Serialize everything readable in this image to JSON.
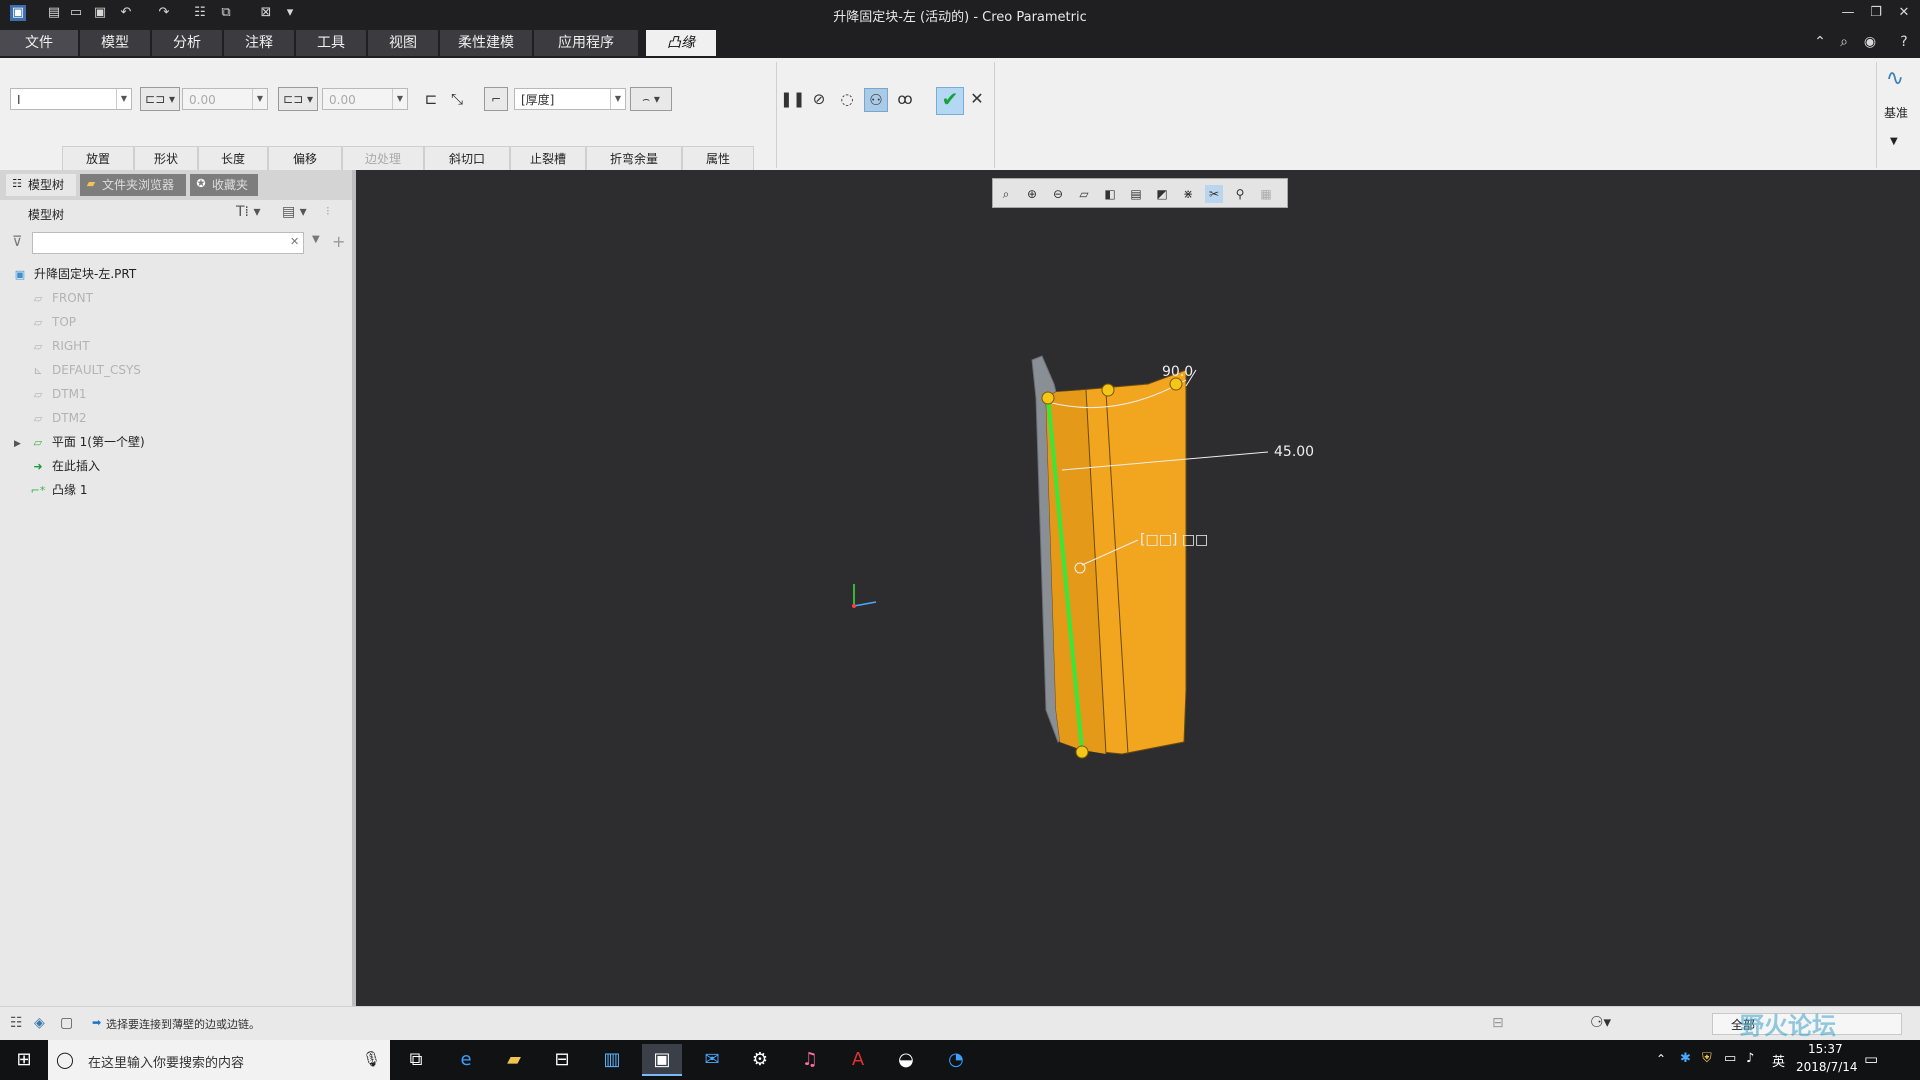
{
  "window": {
    "title": "升降固定块-左 (活动的) - Creo Parametric",
    "quick_access_icons": [
      "app-icon",
      "new-icon",
      "open-icon",
      "save-icon",
      "undo-icon",
      "redo-icon",
      "regenerate-icon",
      "windows-icon",
      "close-window-icon",
      "customize-icon"
    ],
    "controls": [
      "minimize-icon",
      "restore-icon",
      "close-icon"
    ]
  },
  "menu": {
    "tabs": [
      "文件",
      "模型",
      "分析",
      "注释",
      "工具",
      "视图",
      "柔性建模",
      "应用程序",
      "凸缘"
    ],
    "active_tab": "凸缘",
    "right_icons": [
      "collapse-ribbon-icon",
      "search-icon",
      "community-icon",
      "help-icon"
    ]
  },
  "ribbon": {
    "shape_select": "I",
    "length1_value": "0.00",
    "length2_value": "0.00",
    "thickness_select": "[厚度]",
    "controls": [
      "pause-icon",
      "cancel-feature-icon",
      "preview-icon",
      "verify-icon",
      "glasses-icon"
    ],
    "datum_label": "基准",
    "slideup_tabs": [
      {
        "label": "放置",
        "enabled": true
      },
      {
        "label": "形状",
        "enabled": true
      },
      {
        "label": "长度",
        "enabled": true
      },
      {
        "label": "偏移",
        "enabled": true
      },
      {
        "label": "边处理",
        "enabled": false
      },
      {
        "label": "斜切口",
        "enabled": true
      },
      {
        "label": "止裂槽",
        "enabled": true
      },
      {
        "label": "折弯余量",
        "enabled": true
      },
      {
        "label": "属性",
        "enabled": true
      }
    ]
  },
  "left_panel": {
    "tabs": [
      "模型树",
      "文件夹浏览器",
      "收藏夹"
    ],
    "tree_header": "模型树",
    "filter_placeholder": "",
    "tree": [
      {
        "label": "升降固定块-左.PRT",
        "icon": "part-icon",
        "dim": false
      },
      {
        "label": "FRONT",
        "icon": "datum-plane-icon",
        "dim": true
      },
      {
        "label": "TOP",
        "icon": "datum-plane-icon",
        "dim": true
      },
      {
        "label": "RIGHT",
        "icon": "datum-plane-icon",
        "dim": true
      },
      {
        "label": "DEFAULT_CSYS",
        "icon": "csys-icon",
        "dim": true
      },
      {
        "label": "DTM1",
        "icon": "datum-plane-icon",
        "dim": true
      },
      {
        "label": "DTM2",
        "icon": "datum-plane-icon",
        "dim": true
      },
      {
        "label": "平面 1(第一个壁)",
        "icon": "wall-icon",
        "dim": false
      },
      {
        "label": "在此插入",
        "icon": "insert-arrow-icon",
        "dim": false
      },
      {
        "label": "凸缘 1",
        "icon": "flange-icon",
        "dim": false
      }
    ]
  },
  "viewport": {
    "dimensions": [
      "90.0",
      "45.00"
    ],
    "handle_label": "[□□] □□",
    "view_toolbar_icons": [
      "refit-icon",
      "zoom-in-icon",
      "zoom-out-icon",
      "repaint-icon",
      "orient-icon",
      "saved-views-icon",
      "display-style-icon",
      "datum-display-icon",
      "spin-center-icon",
      "annotation-display-icon",
      "appearance-icon"
    ],
    "colors": {
      "flange": "#f2a51e",
      "wall": "#8a8f96",
      "edge": "#39e639",
      "handle": "#f5c518"
    }
  },
  "status": {
    "message": "选择要连接到薄壁的边或边链。",
    "filter_value": "全部"
  },
  "taskbar": {
    "search_placeholder": "在这里输入你要搜索的内容",
    "ime": "英",
    "time": "15:37",
    "date": "2018/7/14",
    "watermark": "野火论坛"
  }
}
